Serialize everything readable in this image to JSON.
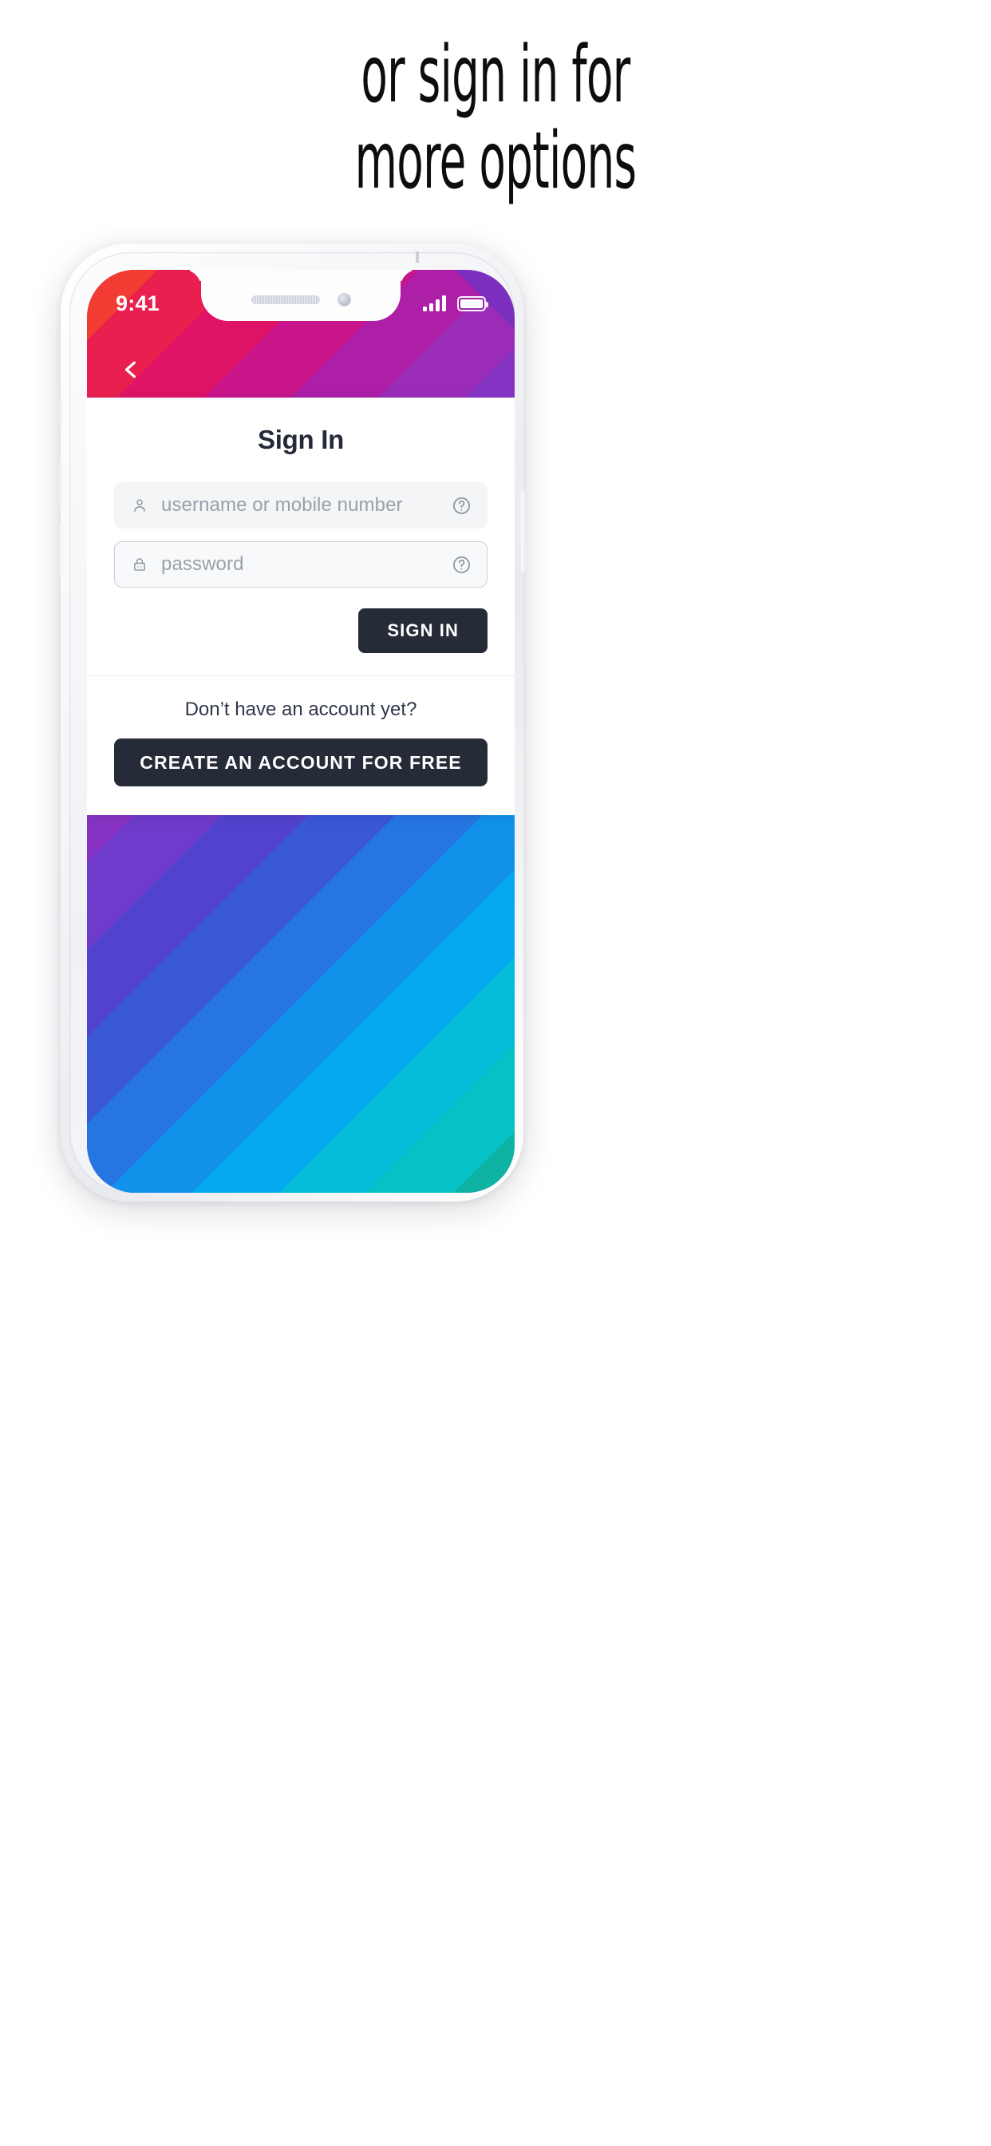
{
  "headline": {
    "line1": "or sign in for",
    "line2": "more options"
  },
  "phone": {
    "statusbar": {
      "time": "9:41",
      "signal_icon": "signal-bars-icon",
      "battery_icon": "battery-full-icon"
    },
    "notch": {
      "speaker_icon": "speaker-grille-icon",
      "camera_icon": "front-camera-icon"
    },
    "nav": {
      "back_icon": "chevron-left-icon"
    },
    "card": {
      "title": "Sign In",
      "username_field": {
        "placeholder": "username or mobile number",
        "value": "",
        "lead_icon": "person-icon",
        "help_icon": "question-circle-icon"
      },
      "password_field": {
        "placeholder": "password",
        "value": "",
        "lead_icon": "lock-icon",
        "help_icon": "question-circle-icon"
      },
      "signin_button": "SIGN IN",
      "no_account_text": "Don’t have an account yet?",
      "create_button": "CREATE AN ACCOUNT FOR FREE"
    }
  },
  "colors": {
    "page_background": "#ffffff",
    "headline_text": "#0d0d0d",
    "card_background": "#ffffff",
    "button_dark": "#262b38",
    "title_text": "#252a38",
    "placeholder_text": "#9aa0ab",
    "field_fill": "#f4f5f7",
    "field_border": "#c9ced8",
    "rainbow_stripes": [
      "#ffb000",
      "#ff9000",
      "#ff6a1f",
      "#f8402f",
      "#e81f4f",
      "#d4147a",
      "#b2219e",
      "#9c2bb5",
      "#7b35c4",
      "#5840cb",
      "#3a5fd9",
      "#1f8ae8",
      "#12a8ee",
      "#06bcd4",
      "#10a99a",
      "#2aa96a",
      "#52b34e",
      "#8bc council",
      "#d4d92b"
    ]
  },
  "rainbow": [
    "#ffb400",
    "#ff9d00",
    "#ff7a14",
    "#fb5a24",
    "#f23b33",
    "#e81f4f",
    "#de1366",
    "#c8158b",
    "#ac1fa6",
    "#9a2cb8",
    "#8633c4",
    "#6f3bcc",
    "#5243ce",
    "#3a57d6",
    "#2576e3",
    "#1192ea",
    "#06a9ef",
    "#04bcd8",
    "#06c2c6",
    "#0fb3a4",
    "#13a881",
    "#24a463",
    "#3faf52",
    "#6cbc46",
    "#9ac93b",
    "#c6d52f",
    "#dbdd26"
  ]
}
